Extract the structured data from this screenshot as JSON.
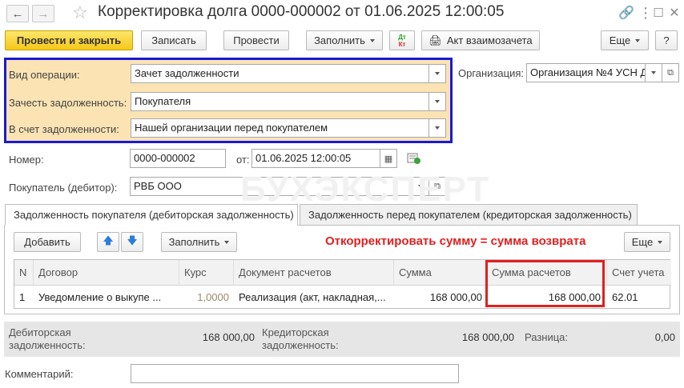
{
  "window": {
    "title": "Корректировка долга 0000-000002 от 01.06.2025 12:00:05"
  },
  "toolbar": {
    "post_close": "Провести и закрыть",
    "save": "Записать",
    "post": "Провести",
    "fill": "Заполнить",
    "dt_kt_top": "Дт",
    "dt_kt_bottom": "Кт",
    "act": "Акт взаимозачета",
    "more": "Еще",
    "help": "?"
  },
  "form": {
    "operation_label": "Вид операции:",
    "operation_value": "Зачет задолженности",
    "offset_label": "Зачесть задолженность:",
    "offset_value": "Покупателя",
    "against_label": "В счет задолженности:",
    "against_value": "Нашей организации перед покупателем",
    "org_label": "Организация:",
    "org_value": "Организация №4 УСН Д",
    "number_label": "Номер:",
    "number_value": "0000-000002",
    "date_from_label": "от:",
    "date_value": "01.06.2025 12:00:05",
    "buyer_label": "Покупатель (дебитор):",
    "buyer_value": "РВБ ООО",
    "comment_label": "Комментарий:",
    "comment_value": ""
  },
  "watermark": "БУХЭКСПЕРТ",
  "tabs": [
    {
      "label": "Задолженность покупателя (дебиторская задолженность)"
    },
    {
      "label": "Задолженность перед покупателем (кредиторская задолженность)"
    }
  ],
  "table_toolbar": {
    "add": "Добавить",
    "fill": "Заполнить",
    "more": "Еще"
  },
  "annotation": "Откорректировать сумму = сумма возврата",
  "table": {
    "headers": [
      "N",
      "Договор",
      "Курс",
      "Документ расчетов",
      "Сумма",
      "Сумма расчетов",
      "Счет учета"
    ],
    "rows": [
      [
        "1",
        "Уведомление о выкупе ...",
        "1,0000",
        "Реализация (акт, накладная,...",
        "168 000,00",
        "168 000,00",
        "62.01"
      ]
    ]
  },
  "totals": {
    "debit_label": "Дебиторская задолженность:",
    "debit_value": "168 000,00",
    "credit_label": "Кредиторская задолженность:",
    "credit_value": "168 000,00",
    "diff_label": "Разница:",
    "diff_value": "0,00"
  },
  "colors": {
    "primary_button": "#f5c81a",
    "group_highlight": "#fbe3b4",
    "group_border": "#1a1ad0",
    "annotation_red": "#e02020"
  }
}
